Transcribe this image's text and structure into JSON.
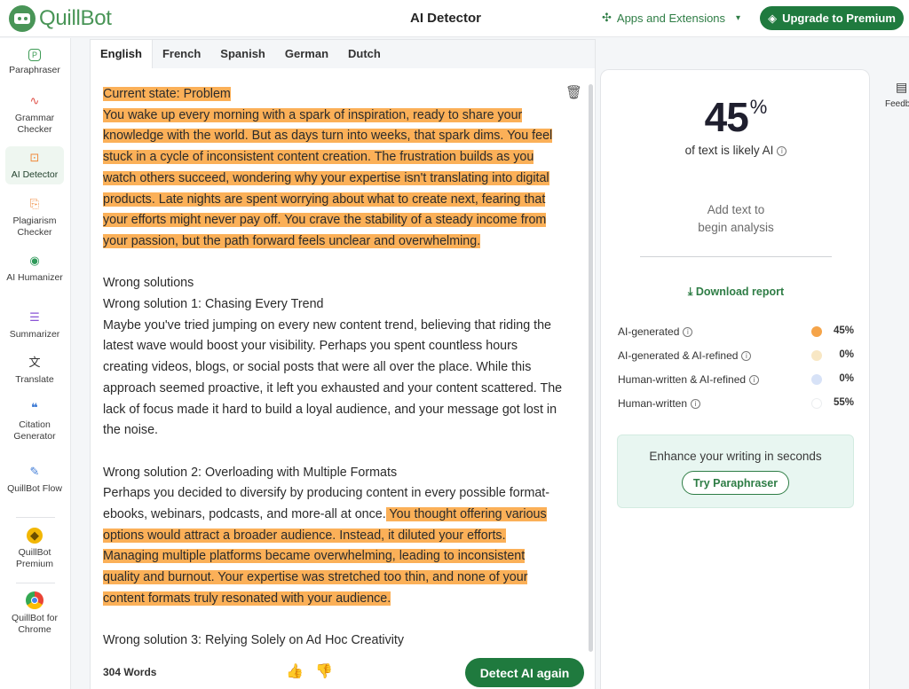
{
  "app": {
    "logo_text": "QuillBot",
    "title": "AI Detector",
    "apps_label": "Apps and Extensions",
    "upgrade_label": "Upgrade to Premium"
  },
  "sidebar": {
    "items": [
      {
        "label": "Paraphraser",
        "icon": "paraphraser-icon"
      },
      {
        "label": "Grammar Checker",
        "icon": "grammar-icon"
      },
      {
        "label": "AI Detector",
        "icon": "ai-detector-icon"
      },
      {
        "label": "Plagiarism Checker",
        "icon": "plagiarism-icon"
      },
      {
        "label": "AI Humanizer",
        "icon": "humanizer-icon"
      },
      {
        "label": "Summarizer",
        "icon": "summarizer-icon"
      },
      {
        "label": "Translate",
        "icon": "translate-icon"
      },
      {
        "label": "Citation Generator",
        "icon": "citation-icon"
      },
      {
        "label": "QuillBot Flow",
        "icon": "flow-icon"
      },
      {
        "label": "QuillBot Premium",
        "icon": "premium-icon"
      },
      {
        "label": "QuillBot for Chrome",
        "icon": "chrome-icon"
      }
    ],
    "active": "AI Detector"
  },
  "editor": {
    "tabs": [
      "English",
      "French",
      "Spanish",
      "German",
      "Dutch"
    ],
    "active_tab": "English",
    "text": {
      "p1_heading": "Current state: Problem",
      "p1_body": "You wake up every morning with a spark of inspiration, ready to share your knowledge with the world. But as days turn into weeks, that spark dims. You feel stuck in a cycle of inconsistent content creation. The frustration builds as you watch others succeed, wondering why your expertise isn't translating into digital products. Late nights are spent worrying about what to create next, fearing that your efforts might never pay off. You crave the stability of a steady income from your passion, but the path forward feels unclear and overwhelming.",
      "p2_heading": "Wrong solutions",
      "p2_sub": "Wrong solution 1: Chasing Every Trend",
      "p2_body": "Maybe you've tried jumping on every new content trend, believing that riding the latest wave would boost your visibility. Perhaps you spent countless hours creating videos, blogs, or social posts that were all over the place. While this approach seemed proactive, it left you exhausted and your content scattered. The lack of focus made it hard to build a loyal audience, and your message got lost in the noise.",
      "p3_heading": "Wrong solution 2: Overloading with Multiple Formats",
      "p3_plain": "Perhaps you decided to diversify by producing content in every possible format-ebooks, webinars, podcasts, and more-all at once.",
      "p3_highlight": " You thought offering various options would attract a broader audience. Instead, it diluted your efforts. Managing multiple platforms became overwhelming, leading to inconsistent quality and burnout. Your expertise was stretched too thin, and none of your content formats truly resonated with your audience.",
      "p4_heading": "Wrong solution 3: Relying Solely on Ad Hoc Creativity"
    },
    "word_count": "304 Words",
    "detect_label": "Detect AI again"
  },
  "results": {
    "percent": "45",
    "percent_sign": "%",
    "likely_label": "of text is likely AI",
    "add_text_line1": "Add text to",
    "add_text_line2": "begin analysis",
    "download_label": "Download report",
    "categories": [
      {
        "label": "AI-generated",
        "value": "45%",
        "color": "#f5a449"
      },
      {
        "label": "AI-generated & AI-refined",
        "value": "0%",
        "color": "#f8e7c4"
      },
      {
        "label": "Human-written & AI-refined",
        "value": "0%",
        "color": "#d7e2f7"
      },
      {
        "label": "Human-written",
        "value": "55%",
        "color": "#ffffff"
      }
    ],
    "enhance_title": "Enhance your writing in seconds",
    "try_label": "Try Paraphraser"
  },
  "feedback_label": "Feedb",
  "colors": {
    "brand": "#499557",
    "button": "#1f7a3e",
    "highlight": "#fbb058"
  }
}
